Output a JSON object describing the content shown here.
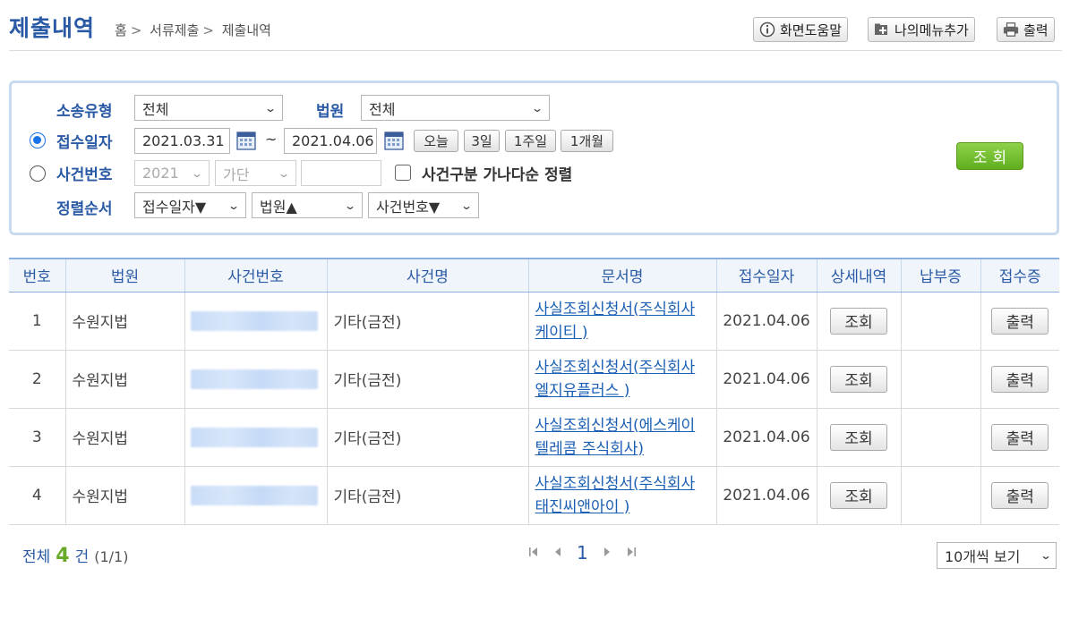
{
  "header": {
    "title": "제출내역",
    "breadcrumb": [
      "홈",
      "서류제출",
      "제출내역"
    ],
    "breadcrumb_sep": ">",
    "buttons": {
      "help": "화면도움말",
      "add_menu": "나의메뉴추가",
      "print": "출력"
    }
  },
  "search": {
    "case_type_label": "소송유형",
    "case_type_value": "전체",
    "court_label": "법원",
    "court_value": "전체",
    "receipt_date_label": "접수일자",
    "date_from": "2021.03.31",
    "date_tilde": "~",
    "date_to": "2021.04.06",
    "quick": [
      "오늘",
      "3일",
      "1주일",
      "1개월"
    ],
    "case_no_label": "사건번호",
    "case_year": "2021",
    "case_kind": "가단",
    "case_no_value": "",
    "sort_checkbox_label": "사건구분 가나다순 정렬",
    "sort_label": "정렬순서",
    "sort1": "접수일자▼",
    "sort2": "법원▲",
    "sort3": "사건번호▼",
    "search_button": "조회"
  },
  "table": {
    "headers": [
      "번호",
      "법원",
      "사건번호",
      "사건명",
      "문서명",
      "접수일자",
      "상세내역",
      "납부증",
      "접수증"
    ],
    "rows": [
      {
        "no": "1",
        "court": "수원지법",
        "case_name": "기타(금전)",
        "doc": "사실조회신청서(주식회사 케이티 )",
        "date": "2021.04.06",
        "detail": "조회",
        "receipt": "출력"
      },
      {
        "no": "2",
        "court": "수원지법",
        "case_name": "기타(금전)",
        "doc": "사실조회신청서(주식회사 엘지유플러스 )",
        "date": "2021.04.06",
        "detail": "조회",
        "receipt": "출력"
      },
      {
        "no": "3",
        "court": "수원지법",
        "case_name": "기타(금전)",
        "doc": "사실조회신청서(에스케이텔레콤 주식회사)",
        "date": "2021.04.06",
        "detail": "조회",
        "receipt": "출력"
      },
      {
        "no": "4",
        "court": "수원지법",
        "case_name": "기타(금전)",
        "doc": "사실조회신청서(주식회사 태진씨앤아이 )",
        "date": "2021.04.06",
        "detail": "조회",
        "receipt": "출력"
      }
    ]
  },
  "footer": {
    "total_prefix": "전체",
    "total_count": "4",
    "total_suffix": "건",
    "page_info": "(1/1)",
    "current_page": "1",
    "page_size": "10개씩 보기"
  },
  "colors": {
    "title": "#2a5aa5",
    "link": "#1a5fb4",
    "search_button": "#6cba2a",
    "count": "#6aaa2a"
  }
}
